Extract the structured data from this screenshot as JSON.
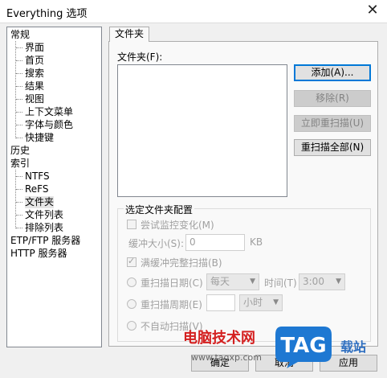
{
  "window": {
    "title": "Everything 选项",
    "close_glyph": "✕"
  },
  "tree": {
    "general": "常规",
    "general_children": [
      "界面",
      "首页",
      "搜索",
      "结果",
      "视图",
      "上下文菜单",
      "字体与颜色",
      "快捷键"
    ],
    "history": "历史",
    "indexes": "索引",
    "index_children": [
      "NTFS",
      "ReFS",
      "文件夹",
      "文件列表",
      "排除列表"
    ],
    "etp": "ETP/FTP 服务器",
    "http": "HTTP 服务器",
    "selected": "文件夹"
  },
  "tab": {
    "label": "文件夹"
  },
  "folders": {
    "label": "文件夹(F):",
    "add": "添加(A)...",
    "remove": "移除(R)",
    "rescan_now": "立即重扫描(U)",
    "rescan_all": "重扫描全部(N)"
  },
  "config": {
    "title": "选定文件夹配置",
    "monitor": "尝试监控变化(M)",
    "buffer_label": "缓冲大小(S):",
    "buffer_value": "0",
    "buffer_unit": "KB",
    "full_rescan": "满缓冲完整扫描(B)",
    "rescan_date": "重扫描日期(C)",
    "day_value": "每天",
    "time_label": "时间(T)",
    "time_value": "3:00",
    "rescan_period": "重扫描周期(E)",
    "period_unit": "小时",
    "no_auto": "不自动扫描(V)"
  },
  "footer": {
    "ok": "确定",
    "cancel": "取消",
    "apply": "应用"
  },
  "watermark": {
    "text": "电脑技术网",
    "url": "www.tagxp.com",
    "logo": "TAG",
    "right": "载站"
  },
  "colors": {
    "accent": "#0078d7",
    "logo_blue": "#1e78d2",
    "watermark_red": "#d42020"
  }
}
